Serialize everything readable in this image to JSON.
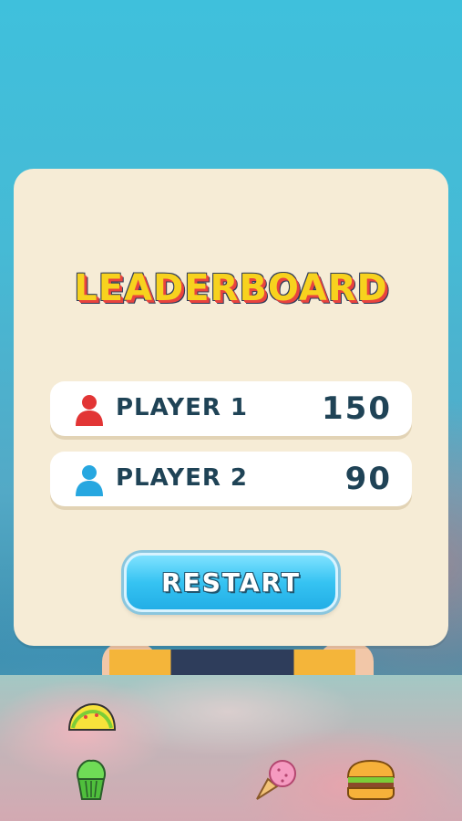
{
  "leaderboard": {
    "title": "LEADERBOARD",
    "players": [
      {
        "name": "PLAYER 1",
        "score": "150",
        "color": "#e23535"
      },
      {
        "name": "PLAYER 2",
        "score": "90",
        "color": "#27a7e0"
      }
    ]
  },
  "buttons": {
    "restart_label": "RESTART"
  },
  "decor": {
    "foods": [
      "taco-icon",
      "cupcake-icon",
      "ice-cream-icon",
      "burger-icon"
    ]
  }
}
